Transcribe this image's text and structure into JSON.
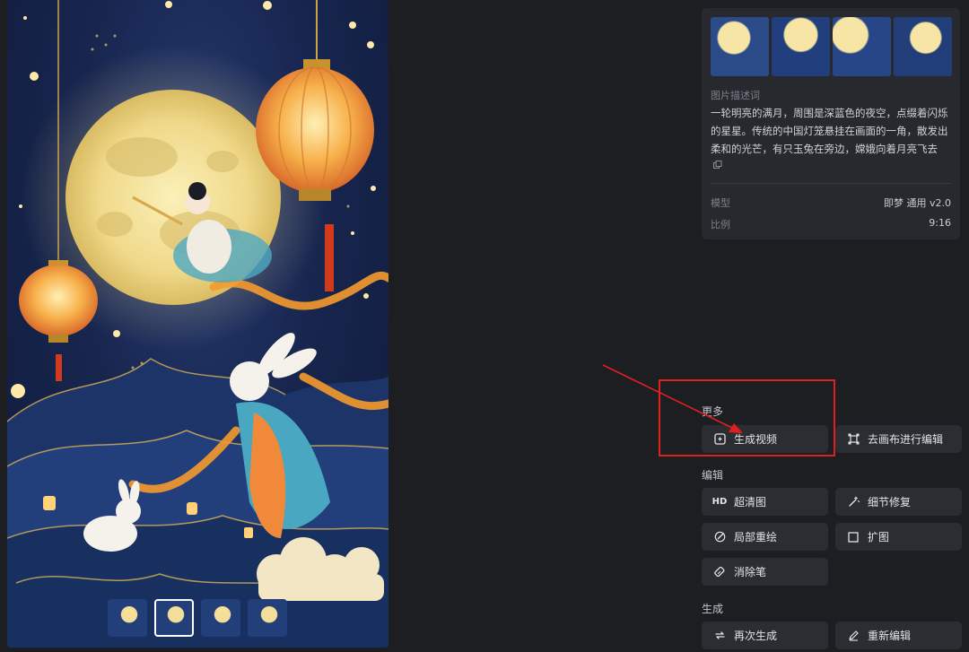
{
  "info": {
    "description_label": "图片描述词",
    "description": "一轮明亮的满月，周围是深蓝色的夜空，点缀着闪烁的星星。传统的中国灯笼悬挂在画面的一角，散发出柔和的光芒，有只玉兔在旁边，嫦娥向着月亮飞去",
    "model_label": "模型",
    "model_value": "即梦 通用 v2.0",
    "ratio_label": "比例",
    "ratio_value": "9:16"
  },
  "sections": {
    "more": "更多",
    "edit": "编辑",
    "generate": "生成"
  },
  "buttons": {
    "generate_video": "生成视频",
    "canvas_edit": "去画布进行编辑",
    "hd_badge": "HD",
    "upscale": "超清图",
    "detail_repair": "细节修复",
    "inpaint": "局部重绘",
    "expand": "扩图",
    "eraser": "消除笔",
    "regenerate": "再次生成",
    "re_edit": "重新编辑"
  },
  "colors": {
    "background": "#1d1e22",
    "card": "#27292e",
    "button": "#2b2d33",
    "annotation": "#e02020"
  }
}
